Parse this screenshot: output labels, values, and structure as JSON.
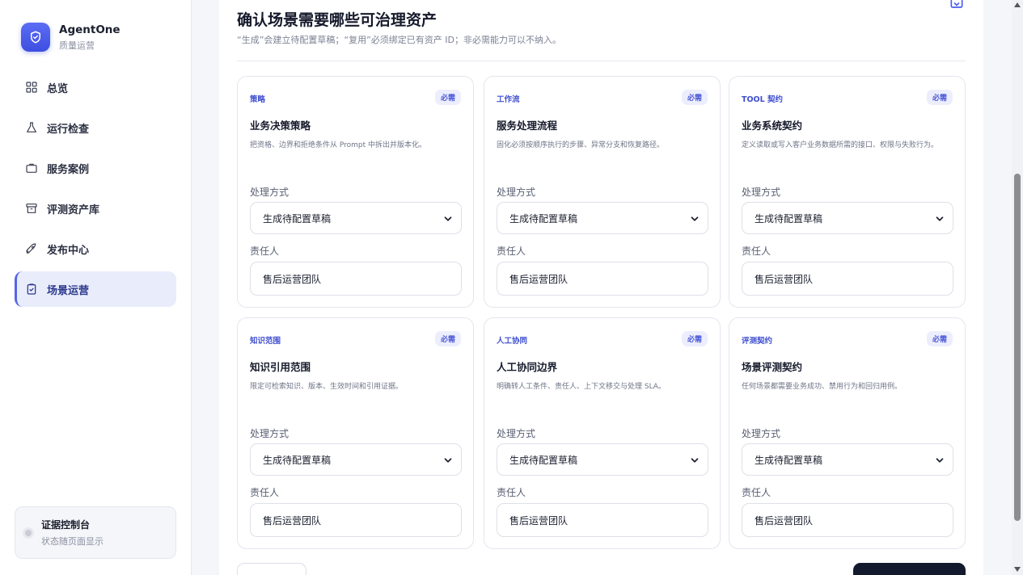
{
  "brand": {
    "name": "AgentOne",
    "subtitle": "质量运营",
    "accent": "#4a5cf0"
  },
  "nav": [
    {
      "label": "总览",
      "icon": "grid-icon"
    },
    {
      "label": "运行检查",
      "icon": "flask-icon"
    },
    {
      "label": "服务案例",
      "icon": "briefcase-icon"
    },
    {
      "label": "评测资产库",
      "icon": "archive-icon"
    },
    {
      "label": "发布中心",
      "icon": "rocket-icon"
    },
    {
      "label": "场景运营",
      "icon": "clipboard-check-icon",
      "active": true
    }
  ],
  "evidence": {
    "title": "证据控制台",
    "subtitle": "状态随页面显示"
  },
  "header": {
    "title": "确认场景需要哪些可治理资产",
    "subtitle": "“生成”会建立待配置草稿；“复用”必须绑定已有资产 ID；非必需能力可以不纳入。"
  },
  "field_labels": {
    "method": "处理方式",
    "owner": "责任人"
  },
  "cards": [
    {
      "category": "策略",
      "badge": "必需",
      "title": "业务决策策略",
      "desc": "把资格、边界和拒绝条件从 Prompt 中拆出并版本化。",
      "method": "生成待配置草稿",
      "owner": "售后运营团队"
    },
    {
      "category": "工作流",
      "badge": "必需",
      "title": "服务处理流程",
      "desc": "固化必须按顺序执行的步骤、异常分支和恢复路径。",
      "method": "生成待配置草稿",
      "owner": "售后运营团队"
    },
    {
      "category": "TOOL 契约",
      "badge": "必需",
      "title": "业务系统契约",
      "desc": "定义读取或写入客户业务数据所需的接口、权限与失败行为。",
      "method": "生成待配置草稿",
      "owner": "售后运营团队"
    },
    {
      "category": "知识范围",
      "badge": "必需",
      "title": "知识引用范围",
      "desc": "限定可检索知识、版本、生效时间和引用证据。",
      "method": "生成待配置草稿",
      "owner": "售后运营团队"
    },
    {
      "category": "人工协同",
      "badge": "必需",
      "title": "人工协同边界",
      "desc": "明确转人工条件、责任人、上下文移交与处理 SLA。",
      "method": "生成待配置草稿",
      "owner": "售后运营团队"
    },
    {
      "category": "评测契约",
      "badge": "必需",
      "title": "场景评测契约",
      "desc": "任何场景都需要业务成功、禁用行为和回归用例。",
      "method": "生成待配置草稿",
      "owner": "售后运营团队"
    }
  ]
}
